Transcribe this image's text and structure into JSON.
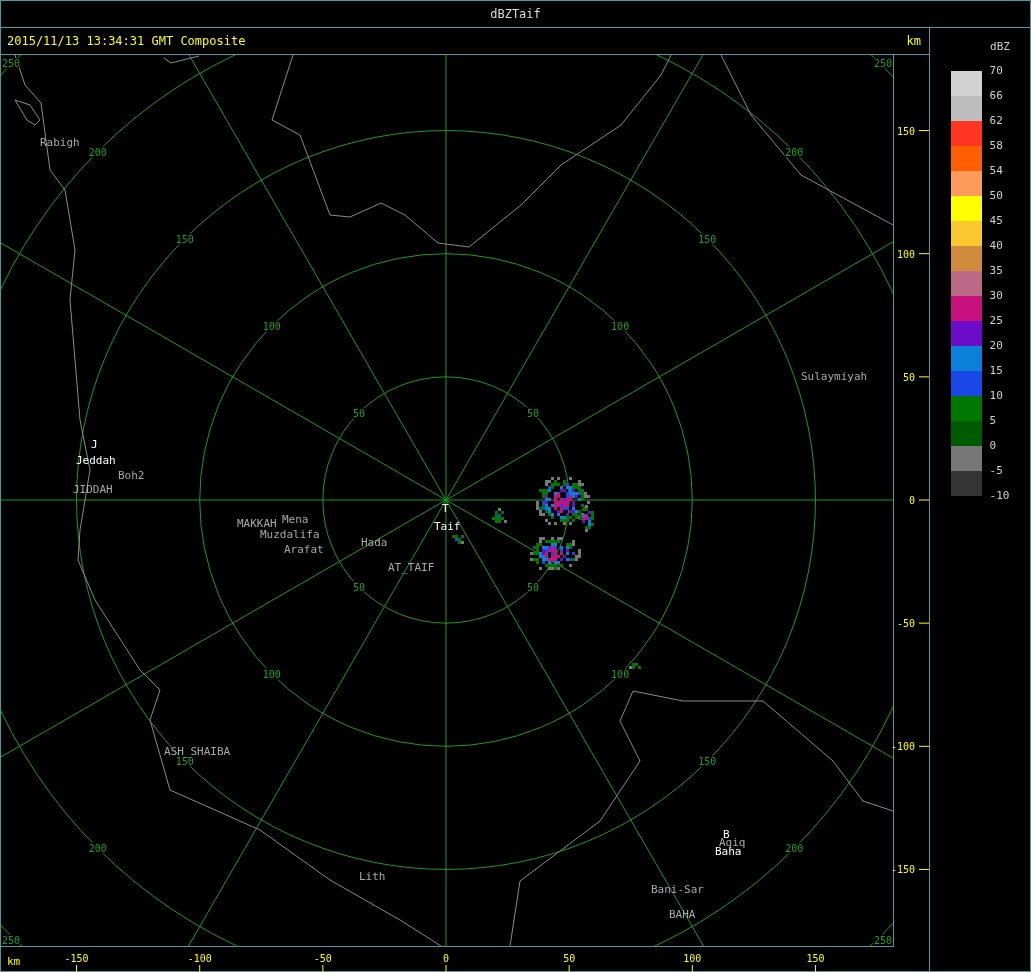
{
  "window": {
    "title": "dBZTaif"
  },
  "header": {
    "timestamp": "2015/11/13 13:34:31 GMT Composite",
    "unit": "km"
  },
  "map": {
    "ring_labels": [
      {
        "text": "50"
      },
      {
        "text": "50"
      },
      {
        "text": "50"
      },
      {
        "text": "50"
      },
      {
        "text": "100"
      },
      {
        "text": "100"
      },
      {
        "text": "100"
      },
      {
        "text": "100"
      },
      {
        "text": "150"
      },
      {
        "text": "150"
      },
      {
        "text": "150"
      },
      {
        "text": "150"
      },
      {
        "text": "200"
      },
      {
        "text": "200"
      },
      {
        "text": "200"
      },
      {
        "text": "200"
      },
      {
        "text": "250"
      },
      {
        "text": "250"
      },
      {
        "text": "250"
      },
      {
        "text": "250"
      }
    ],
    "places": [
      {
        "text": "Rabigh",
        "kind": "town"
      },
      {
        "text": "J",
        "kind": "site"
      },
      {
        "text": "Jeddah",
        "kind": "site"
      },
      {
        "text": "Boh2",
        "kind": "town"
      },
      {
        "text": "JIDDAH",
        "kind": "town"
      },
      {
        "text": "MAKKAH",
        "kind": "town"
      },
      {
        "text": "Mena",
        "kind": "town"
      },
      {
        "text": "Muzdalifa",
        "kind": "town"
      },
      {
        "text": "Arafat",
        "kind": "town"
      },
      {
        "text": "Hada",
        "kind": "town"
      },
      {
        "text": "T",
        "kind": "site"
      },
      {
        "text": "Taif",
        "kind": "site"
      },
      {
        "text": "AT_TAIF",
        "kind": "town"
      },
      {
        "text": "Sulaymiyah",
        "kind": "town"
      },
      {
        "text": "B",
        "kind": "site"
      },
      {
        "text": "Aqiq",
        "kind": "town"
      },
      {
        "text": "Baha",
        "kind": "site"
      },
      {
        "text": "Bani-Sar",
        "kind": "town"
      },
      {
        "text": "BAHA",
        "kind": "town"
      },
      {
        "text": "Lith",
        "kind": "town"
      },
      {
        "text": "ASH_SHAIBA",
        "kind": "town"
      }
    ]
  },
  "y_axis": {
    "ticks": [
      "150",
      "100",
      "50",
      "0",
      "-50",
      "-100",
      "-150"
    ]
  },
  "x_axis": {
    "unit": "km",
    "ticks": [
      "-150",
      "-100",
      "-50",
      "0",
      "50",
      "100",
      "150"
    ]
  },
  "legend": {
    "title": "dBZ",
    "bands": [
      {
        "color": "#d3d3d3"
      },
      {
        "color": "#bebebe"
      },
      {
        "color": "#ff3522"
      },
      {
        "color": "#ff5f00"
      },
      {
        "color": "#ff9b5a"
      },
      {
        "color": "#ffff00"
      },
      {
        "color": "#fbc832"
      },
      {
        "color": "#d08a3e"
      },
      {
        "color": "#bc6a87"
      },
      {
        "color": "#c8107e"
      },
      {
        "color": "#6c0cc8"
      },
      {
        "color": "#0a80d8"
      },
      {
        "color": "#1a48e8"
      },
      {
        "color": "#007800"
      },
      {
        "color": "#005a00"
      },
      {
        "color": "#777777"
      },
      {
        "color": "#353535"
      }
    ],
    "labels": [
      "70",
      "66",
      "62",
      "58",
      "54",
      "50",
      "45",
      "40",
      "35",
      "30",
      "25",
      "20",
      "15",
      "10",
      "5",
      "0",
      "-5",
      "-10"
    ]
  }
}
